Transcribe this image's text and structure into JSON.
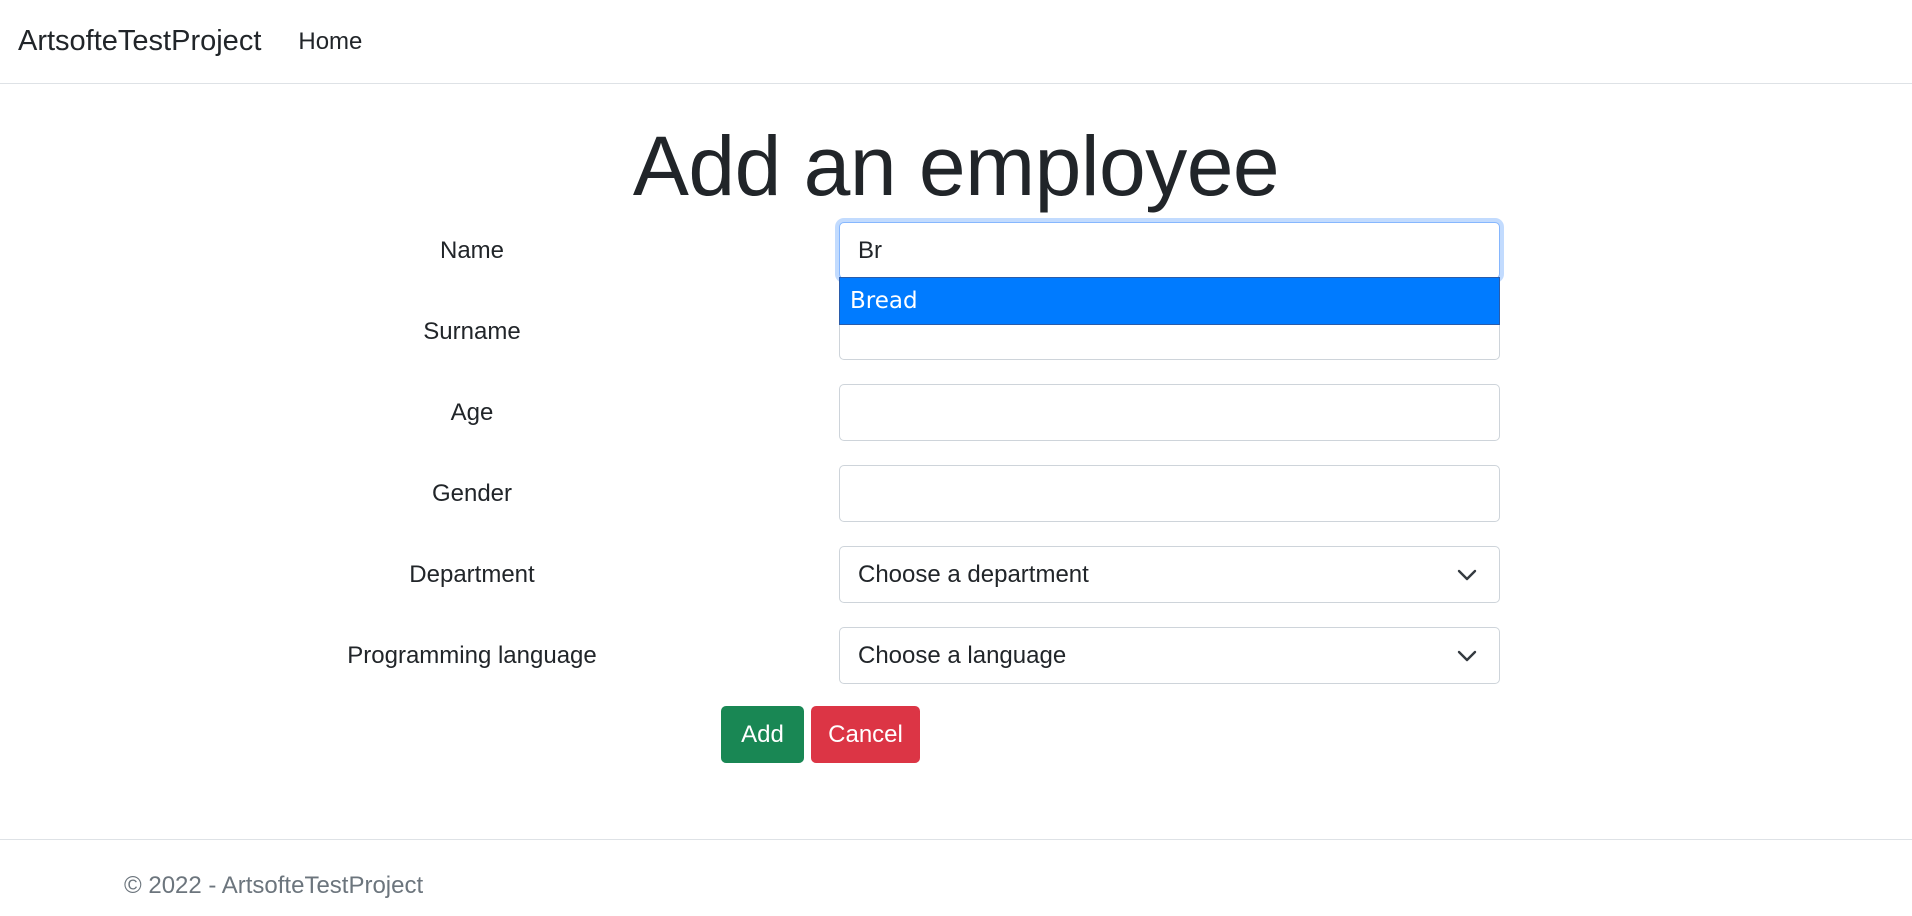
{
  "navbar": {
    "brand": "ArtsofteTestProject",
    "links": [
      {
        "label": "Home"
      }
    ]
  },
  "page": {
    "title": "Add an employee"
  },
  "form": {
    "name": {
      "label": "Name",
      "value": "Br"
    },
    "autocomplete": {
      "suggestion": "Bread"
    },
    "surname": {
      "label": "Surname",
      "value": ""
    },
    "age": {
      "label": "Age",
      "value": ""
    },
    "gender": {
      "label": "Gender",
      "value": ""
    },
    "department": {
      "label": "Department",
      "selected": "Choose a department"
    },
    "language": {
      "label": "Programming language",
      "selected": "Choose a language"
    },
    "buttons": {
      "add": "Add",
      "cancel": "Cancel"
    }
  },
  "footer": {
    "text": "© 2022 - ArtsofteTestProject"
  },
  "colors": {
    "primary_highlight": "#007bff",
    "success": "#198754",
    "danger": "#dc3545",
    "focus_border": "#86b7fe"
  },
  "icons": {
    "select_arrow": "chevron-down-icon"
  }
}
